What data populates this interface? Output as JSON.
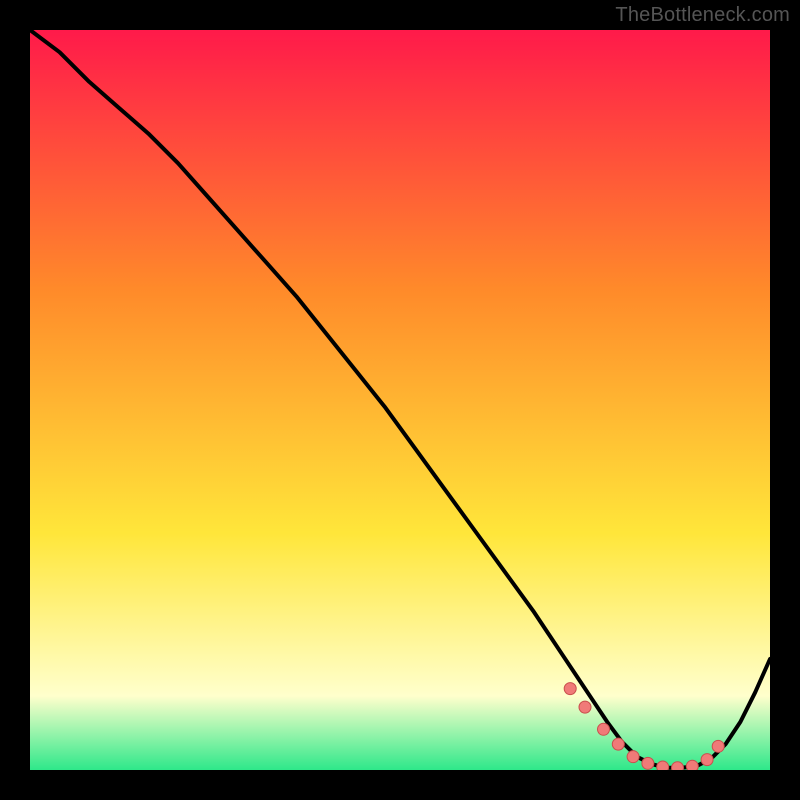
{
  "watermark": "TheBottleneck.com",
  "colors": {
    "frame": "#000000",
    "gradient_top": "#ff1a4a",
    "gradient_mid1": "#ff8a2a",
    "gradient_mid2": "#ffe63a",
    "gradient_bottom_highlight": "#ffffcc",
    "gradient_bottom": "#2ee88a",
    "curve": "#000000",
    "dot_fill": "#f07a78",
    "dot_stroke": "#c94f4d"
  },
  "chart_data": {
    "type": "line",
    "title": "",
    "xlabel": "",
    "ylabel": "",
    "xlim": [
      0,
      100
    ],
    "ylim": [
      0,
      100
    ],
    "series": [
      {
        "name": "bottleneck-curve",
        "x": [
          0,
          4,
          8,
          12,
          16,
          20,
          24,
          28,
          32,
          36,
          40,
          44,
          48,
          52,
          56,
          60,
          64,
          68,
          70,
          72,
          74,
          76,
          78,
          80,
          82,
          84,
          86,
          88,
          90,
          92,
          94,
          96,
          98,
          100
        ],
        "y": [
          100,
          97,
          93,
          89.5,
          86,
          82,
          77.5,
          73,
          68.5,
          64,
          59,
          54,
          49,
          43.5,
          38,
          32.5,
          27,
          21.5,
          18.5,
          15.5,
          12.5,
          9.5,
          6.5,
          3.8,
          1.8,
          0.8,
          0.3,
          0.3,
          0.5,
          1.5,
          3.5,
          6.5,
          10.5,
          15
        ]
      }
    ],
    "optimal_points": {
      "name": "optimal-zone-dots",
      "x": [
        73,
        75,
        77.5,
        79.5,
        81.5,
        83.5,
        85.5,
        87.5,
        89.5,
        91.5,
        93
      ],
      "y": [
        11,
        8.5,
        5.5,
        3.5,
        1.8,
        0.9,
        0.4,
        0.3,
        0.5,
        1.4,
        3.2
      ]
    }
  }
}
